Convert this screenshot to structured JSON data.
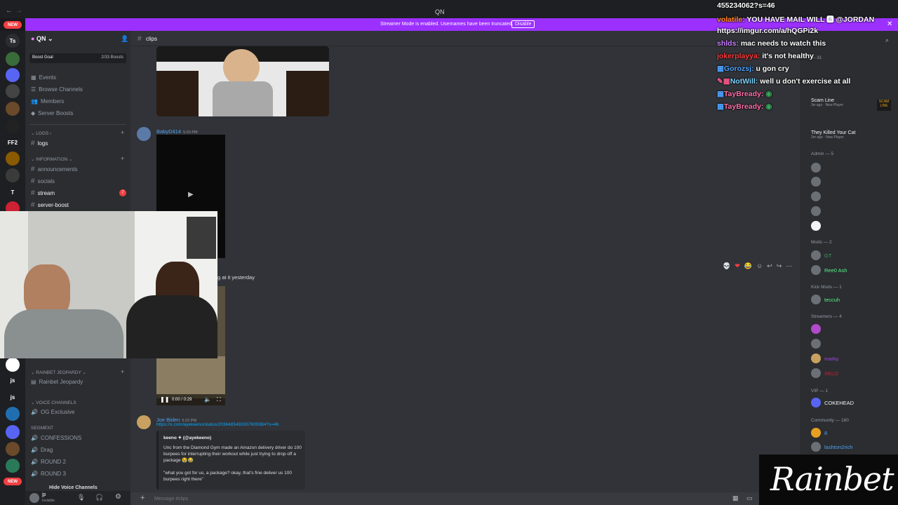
{
  "titlebar": {
    "title": "QN"
  },
  "banner": {
    "text": "Streamer Mode is enabled. Usernames have been truncated.",
    "button": "Disable"
  },
  "rail": {
    "items": [
      "Ts",
      "202",
      "",
      "",
      "",
      "FF2",
      "199",
      "",
      "T",
      ""
    ],
    "new_top": "NEW",
    "new_bottom": "NEW"
  },
  "server": {
    "name": "QN",
    "boost_goal": "Boost Goal",
    "boosts": "2/33 Boosts"
  },
  "menu": [
    "Events",
    "Browse Channels",
    "Members",
    "Server Boosts"
  ],
  "channels": {
    "logs_cat": "LOGS",
    "logs": "logs",
    "info_cat": "INFORMATION",
    "info": [
      "announcements",
      "socials",
      "stream",
      "server-boost"
    ],
    "stream_badge": "7",
    "rainbet_cat": "Rainbet Jeopardy",
    "rainbet": "Rainbet Jeopardy",
    "voice_cat": "Voice Channels",
    "voice": "OG Exclusive",
    "segment_cat": "Segment",
    "segment": [
      "CONFESSIONS",
      "Drag",
      "ROUND 2",
      "ROUND 3"
    ],
    "hide_voice": "Hide Voice Channels"
  },
  "user": {
    "name": "jp",
    "status": "Invisible"
  },
  "header": {
    "channel": "clips"
  },
  "messages": [
    {
      "author": "BabyD414",
      "time": "5:20 PM"
    },
    {
      "author": "Joe Biden",
      "time": "5:22 PM",
      "link": "https://x.com/ayekeeno/status/2036485493307609384?s=46",
      "embed_author": "keeno ✦ (@ayekeeno)",
      "embed_text": "Unc from the Diamond Gym made an Amazon delivery driver do 100 burpees for interrupting their workout while just trying to drop off a package 😭😂",
      "embed_quote": "\"what you got for us, a package? okay, that's fine deliver us 100 burpees right there\""
    }
  ],
  "partial_text": "g at it yesterday",
  "video": {
    "time": "0:00 / 0:29"
  },
  "composer": {
    "placeholder": "Message #clips"
  },
  "members": {
    "top_label": "— 31",
    "items_top": [
      {
        "name": "Scam Line",
        "sub": "3w ago · New Player"
      },
      {
        "name": "They Killed Your Cat",
        "sub": "2m ago · New Player"
      }
    ],
    "admin": "Admin — 5",
    "mods": "Mods — 2",
    "mod_names": [
      "GT",
      "Ree0 Ash"
    ],
    "kick": "Kick Mods — 1",
    "kick_names": [
      "teccuh"
    ],
    "streamers": "Streamers — 4",
    "streamer_names": [
      "marky",
      "XELO"
    ],
    "vip": "VIP — 1",
    "vip_names": [
      "COKEHEAD"
    ],
    "community": "Community — 160",
    "community_names": [
      "8",
      "lashton2rich"
    ]
  },
  "stream_chat": [
    {
      "user": "",
      "text": "455234062?s=46",
      "ucolor": "#fff"
    },
    {
      "user": "volatile:",
      "text": "YOU HAVE MAIL WILL 🅱 @JORDAN",
      "ucolor": "#ff8c1a"
    },
    {
      "user": "",
      "text": "https://imgur.com/a/hQGPi2k",
      "ucolor": "#fff"
    },
    {
      "user": "shlds:",
      "text": "mac needs to watch this",
      "ucolor": "#c77dff"
    },
    {
      "user": "jokerplayya:",
      "text": "it's not healthy",
      "ucolor": "#ff3b3b"
    },
    {
      "user": "Gorozsj:",
      "text": "u gon cry",
      "ucolor": "#4fa3ff"
    },
    {
      "user": "NotWill:",
      "text": "well u don't exercise at all",
      "ucolor": "#7fd4ff"
    },
    {
      "user": "TayBready:",
      "text": "",
      "ucolor": "#ff6fa8"
    },
    {
      "user": "TayBready:",
      "text": "",
      "ucolor": "#ff6fa8"
    }
  ],
  "logo": {
    "text": "Rainbet"
  }
}
